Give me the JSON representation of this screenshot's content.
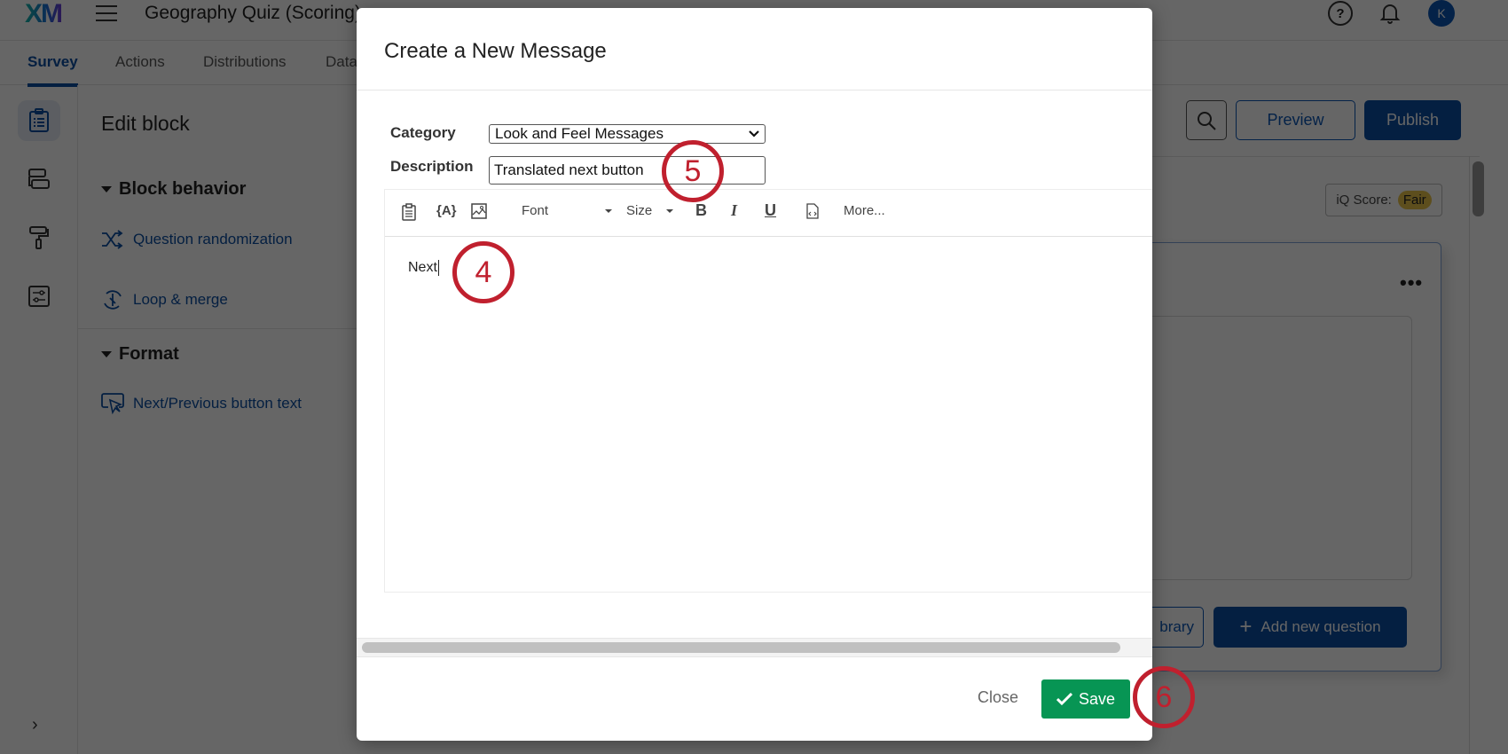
{
  "app": {
    "logo": "XM",
    "survey_title": "Geography Quiz (Scoring)",
    "avatar_initial": "K",
    "tabs": [
      {
        "label": "Survey",
        "active": true
      },
      {
        "label": "Actions",
        "active": false
      },
      {
        "label": "Distributions",
        "active": false
      },
      {
        "label": "Data",
        "active": false
      }
    ],
    "rail_icons": [
      "survey-clipboard-icon",
      "blocks-flow-icon",
      "paint-roller-icon",
      "survey-options-icon"
    ],
    "edit_panel": {
      "title": "Edit block",
      "sections": [
        {
          "heading": "Block behavior",
          "links": [
            "Question randomization",
            "Loop & merge"
          ]
        },
        {
          "heading": "Format",
          "links": [
            "Next/Previous button text"
          ]
        }
      ]
    },
    "header_buttons": {
      "preview": "Preview",
      "publish": "Publish"
    },
    "iq_score": {
      "label": "iQ Score:",
      "value": "Fair"
    },
    "block_more": "•••",
    "import_library": "brary",
    "add_question": "Add new question"
  },
  "modal": {
    "title": "Create a New Message",
    "category_label": "Category",
    "category_value": "Look and Feel Messages",
    "description_label": "Description",
    "description_value": "Translated next button",
    "toolbar": {
      "font": "Font",
      "size": "Size",
      "bold": "B",
      "italic": "I",
      "underline": "U",
      "more": "More..."
    },
    "editor_text": "Next",
    "close_label": "Close",
    "save_label": "Save"
  },
  "annotations": {
    "step4": "4",
    "step5": "5",
    "step6": "6"
  },
  "colors": {
    "brand_blue": "#0b4ea2",
    "save_green": "#079554",
    "annotation_red": "#c0202e",
    "iq_fair": "#e9c449"
  }
}
